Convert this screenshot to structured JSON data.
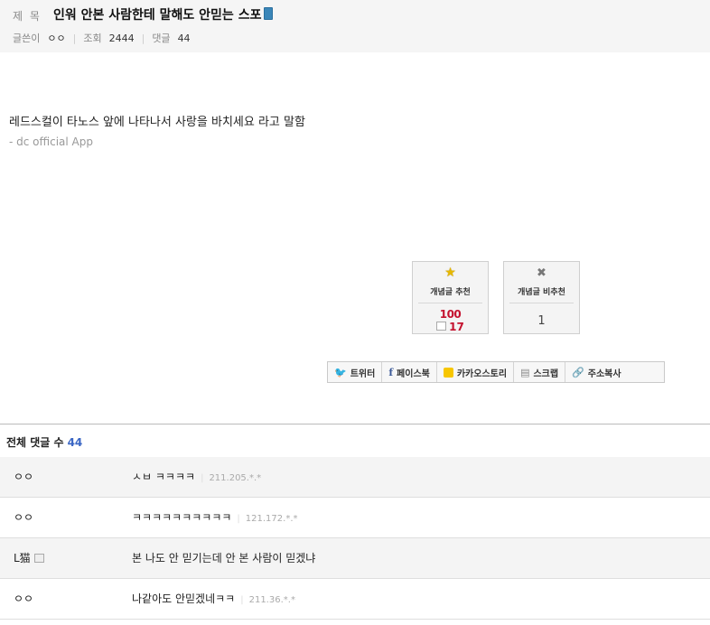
{
  "post": {
    "title_label": "제 목",
    "title": "인워 안본 사람한테 말해도 안믿는 스포",
    "meta": {
      "author_label": "글쓴이",
      "author": "ㅇㅇ",
      "views_label": "조회",
      "views": "2444",
      "comments_label": "댓글",
      "comments": "44"
    },
    "body": "레드스컬이 타노스 앞에 나타나서 사랑을 바치세요 라고 말함",
    "signature": "- dc official App"
  },
  "vote": {
    "up_label": "개념글 추천",
    "up_count": "100",
    "fix_count": "17",
    "down_label": "개념글 비추천",
    "down_count": "1"
  },
  "share": {
    "twitter": "트위터",
    "facebook": "페이스북",
    "kakaostory": "카카오스토리",
    "scrap": "스크랩",
    "copy_url": "주소복사"
  },
  "comments": {
    "header_label": "전체 댓글 수",
    "total": "44",
    "items": [
      {
        "name": "ㅇㅇ",
        "text": "ㅅㅂ ㅋㅋㅋㅋ",
        "ip": "211.205.*.*"
      },
      {
        "name": "ㅇㅇ",
        "text": "ㅋㅋㅋㅋㅋㅋㅋㅋㅋㅋ",
        "ip": "121.172.*.*"
      },
      {
        "name": "L猫",
        "text": "본 나도 안 믿기는데 안 본 사람이 믿겠냐",
        "ip": ""
      },
      {
        "name": "ㅇㅇ",
        "text": "나같아도 안믿겠네ㅋㅋ",
        "ip": "211.36.*.*"
      }
    ]
  }
}
